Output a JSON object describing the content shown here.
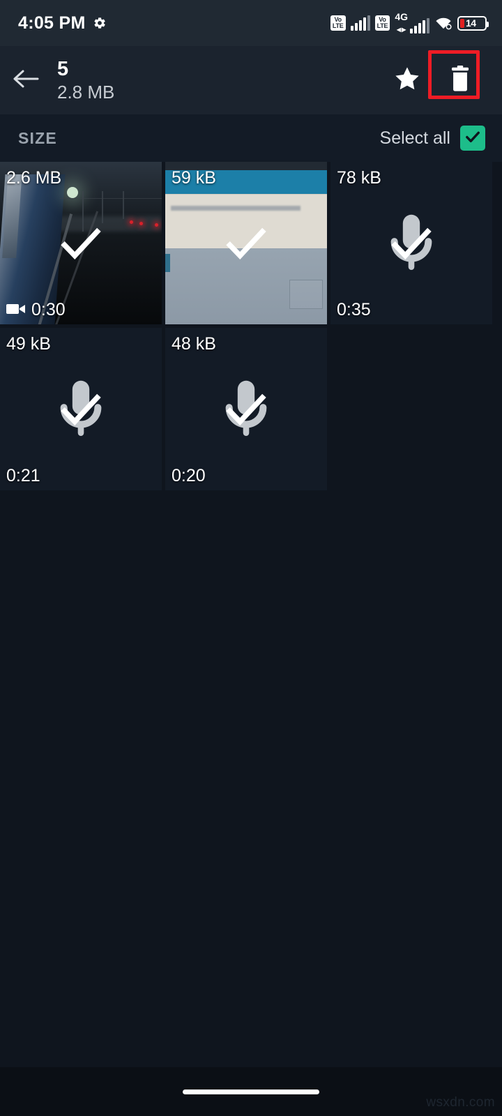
{
  "status_bar": {
    "time": "4:05 PM",
    "gear_icon": "gear-icon",
    "volte_top": "Vo",
    "volte_bottom": "LTE",
    "network_type": "4G",
    "wifi_icon": "wifi-icon",
    "battery_level": "14"
  },
  "app_bar": {
    "back_icon": "arrow-left-icon",
    "selected_count": "5",
    "selected_size": "2.8 MB",
    "star_icon": "star-icon",
    "delete_icon": "trash-icon",
    "highlight_color": "#ee1c25"
  },
  "section": {
    "label": "SIZE",
    "select_all_label": "Select all",
    "select_all_checked": true,
    "checkbox_color": "#1dbd8a"
  },
  "grid": {
    "tiles": [
      {
        "size": "2.6 MB",
        "duration": "0:30",
        "kind": "video",
        "selected": true,
        "has_video_icon": true
      },
      {
        "size": "59 kB",
        "duration": "",
        "kind": "image",
        "selected": true,
        "has_video_icon": false
      },
      {
        "size": "78 kB",
        "duration": "0:35",
        "kind": "audio",
        "selected": true,
        "has_video_icon": false
      },
      {
        "size": "49 kB",
        "duration": "0:21",
        "kind": "audio",
        "selected": true,
        "has_video_icon": false
      },
      {
        "size": "48 kB",
        "duration": "0:20",
        "kind": "audio",
        "selected": true,
        "has_video_icon": false
      }
    ]
  },
  "nav_bar": {
    "home_indicator": "home-indicator"
  },
  "watermark": {
    "text": "wsxdn.com"
  }
}
